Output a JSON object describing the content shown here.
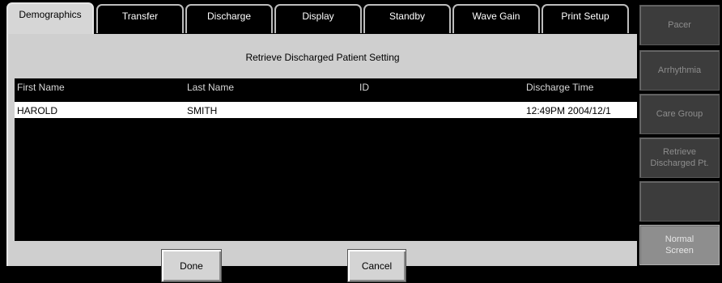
{
  "tabs": [
    {
      "label": "Demographics",
      "active": true
    },
    {
      "label": "Transfer",
      "active": false
    },
    {
      "label": "Discharge",
      "active": false
    },
    {
      "label": "Display",
      "active": false
    },
    {
      "label": "Standby",
      "active": false
    },
    {
      "label": "Wave Gain",
      "active": false
    },
    {
      "label": "Print Setup",
      "active": false
    }
  ],
  "panel": {
    "title": "Retrieve Discharged Patient Setting",
    "columns": [
      "First Name",
      "Last Name",
      "ID",
      "Discharge Time"
    ],
    "rows": [
      {
        "first": "HAROLD",
        "last": "SMITH",
        "id": "",
        "time": "12:49PM 2004/12/1"
      }
    ],
    "done_label": "Done",
    "cancel_label": "Cancel"
  },
  "side_menu": [
    {
      "label": "Pacer"
    },
    {
      "label": "Arrhythmia"
    },
    {
      "label": "Care Group"
    },
    {
      "label": "Retrieve\nDischarged Pt."
    },
    {
      "label": ""
    },
    {
      "label": "Normal\nScreen"
    }
  ],
  "colors": {
    "panel_bg": "#cfcfcf",
    "side_button_bg": "#3c3c3c",
    "side_button_active_bg": "#8e8e8e",
    "table_bg": "#000000",
    "selected_row_bg": "#ffffff"
  }
}
